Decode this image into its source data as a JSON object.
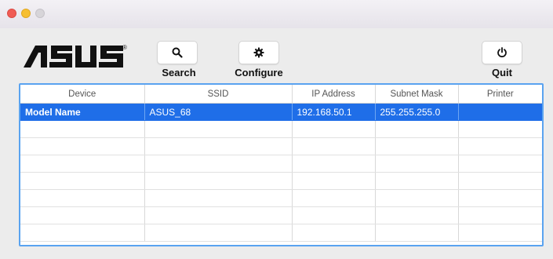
{
  "app": {
    "logo_text": "ASUS",
    "logo_mark": "®"
  },
  "toolbar": {
    "search": {
      "label": "Search",
      "icon": "search-icon"
    },
    "configure": {
      "label": "Configure",
      "icon": "gear-icon"
    },
    "quit": {
      "label": "Quit",
      "icon": "power-icon"
    }
  },
  "table": {
    "columns": [
      "Device",
      "SSID",
      "IP Address",
      "Subnet Mask",
      "Printer"
    ],
    "rows": [
      {
        "device": "Model Name",
        "ssid": "ASUS_68",
        "ip": "192.168.50.1",
        "mask": "255.255.255.0",
        "printer": ""
      }
    ]
  },
  "colors": {
    "accent": "#1f6ee8",
    "focus_ring": "#5aa3f0",
    "close": "#f05c55",
    "minimize": "#f6bf31"
  }
}
